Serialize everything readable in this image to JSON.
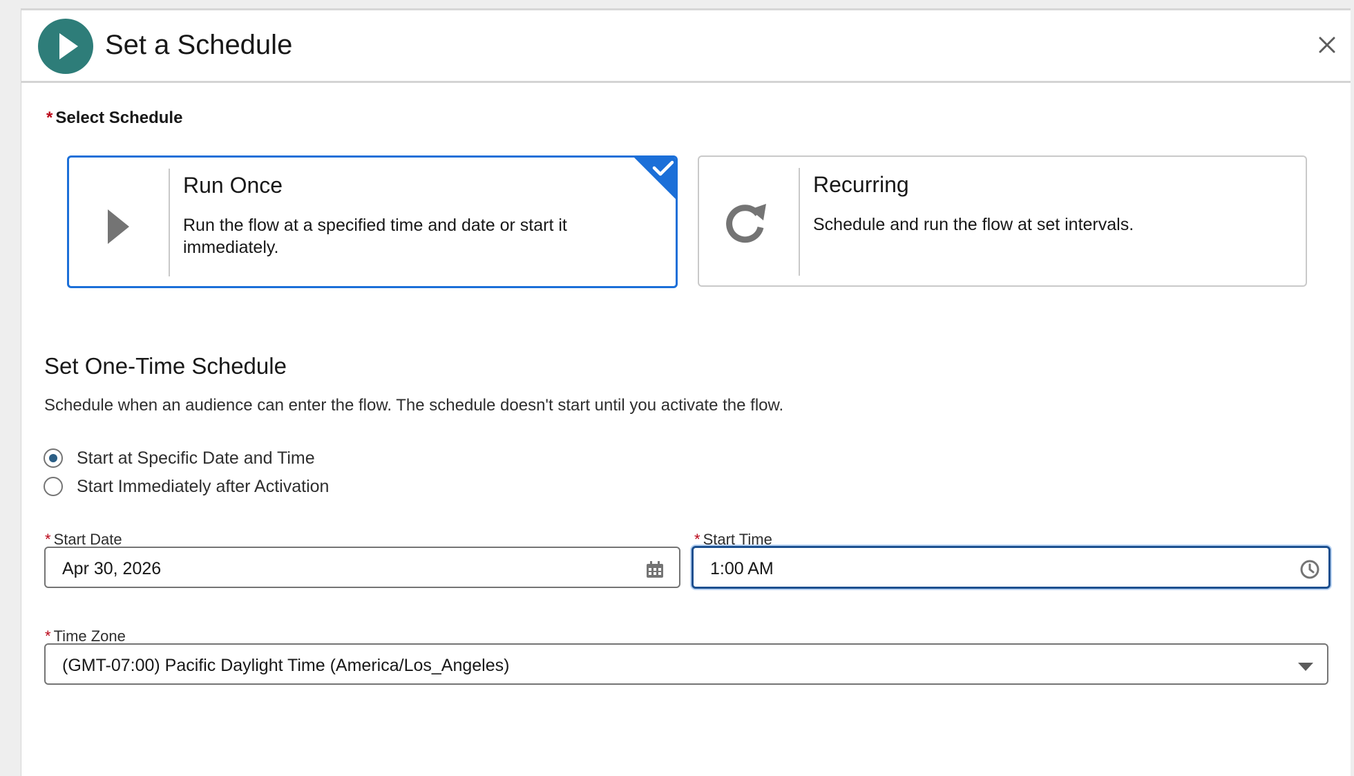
{
  "header": {
    "title": "Set a Schedule",
    "icon": "play-icon",
    "close_icon": "close-icon",
    "accent_color": "#2e7d79"
  },
  "select_schedule": {
    "required_marker": "*",
    "label": "Select Schedule",
    "options": [
      {
        "title": "Run Once",
        "description": "Run the flow at a specified time and date or start it immediately.",
        "icon": "play-triangle-icon",
        "selected": true
      },
      {
        "title": "Recurring",
        "description": "Schedule and run the flow at set intervals.",
        "icon": "refresh-icon",
        "selected": false
      }
    ]
  },
  "one_time": {
    "title": "Set One-Time Schedule",
    "description": "Schedule when an audience can enter the flow. The schedule doesn't start until you activate the flow.",
    "radios": [
      {
        "label": "Start at Specific Date and Time",
        "checked": true
      },
      {
        "label": "Start Immediately after Activation",
        "checked": false
      }
    ]
  },
  "fields": {
    "start_date": {
      "required_marker": "*",
      "label": "Start Date",
      "value": "Apr 30, 2026",
      "icon": "calendar-icon"
    },
    "start_time": {
      "required_marker": "*",
      "label": "Start Time",
      "value": "1:00 AM",
      "icon": "clock-icon"
    },
    "time_zone": {
      "required_marker": "*",
      "label": "Time Zone",
      "value": "(GMT-07:00) Pacific Daylight Time (America/Los_Angeles)",
      "icon": "chevron-down-icon"
    }
  }
}
